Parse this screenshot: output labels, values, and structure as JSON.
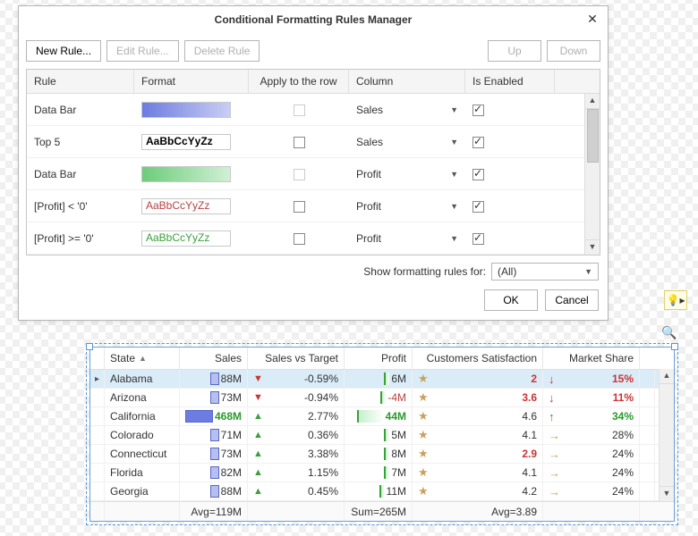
{
  "dialog": {
    "title": "Conditional Formatting Rules Manager",
    "buttons": {
      "new": "New Rule...",
      "edit": "Edit Rule...",
      "delete": "Delete Rule",
      "up": "Up",
      "down": "Down",
      "ok": "OK",
      "cancel": "Cancel"
    },
    "columns": {
      "rule": "Rule",
      "format": "Format",
      "apply": "Apply to the row",
      "column": "Column",
      "enabled": "Is Enabled"
    },
    "rules": [
      {
        "name": "Data Bar",
        "format_kind": "bar-blue",
        "format_text": "",
        "apply_row": false,
        "apply_faded": true,
        "column": "Sales",
        "enabled": true
      },
      {
        "name": "Top 5",
        "format_kind": "text",
        "format_text": "AaBbCcYyZz",
        "format_css": "fmt-bold",
        "apply_row": false,
        "apply_faded": false,
        "column": "Sales",
        "enabled": true
      },
      {
        "name": "Data Bar",
        "format_kind": "bar-green",
        "format_text": "",
        "apply_row": false,
        "apply_faded": true,
        "column": "Profit",
        "enabled": true
      },
      {
        "name": "[Profit] < '0'",
        "format_kind": "text",
        "format_text": "AaBbCcYyZz",
        "format_css": "fmt-red",
        "apply_row": false,
        "apply_faded": false,
        "column": "Profit",
        "enabled": true
      },
      {
        "name": "[Profit] >= '0'",
        "format_kind": "text",
        "format_text": "AaBbCcYyZz",
        "format_css": "fmt-green",
        "apply_row": false,
        "apply_faded": false,
        "column": "Profit",
        "enabled": true
      }
    ],
    "filter_label": "Show formatting rules for:",
    "filter_value": "(All)"
  },
  "grid": {
    "headers": {
      "state": "State",
      "sales": "Sales",
      "svt": "Sales vs Target",
      "profit": "Profit",
      "cs": "Customers Satisfaction",
      "ms": "Market Share"
    },
    "rows": [
      {
        "selected": true,
        "state": "Alabama",
        "sales": "88M",
        "sales_bold": false,
        "svt_dir": "dn",
        "svt": "-0.59%",
        "profit": "6M",
        "profit_bold": false,
        "cs": "2",
        "cs_bold": true,
        "ms_dir": "dn",
        "ms": "15%",
        "ms_bold": true
      },
      {
        "selected": false,
        "state": "Arizona",
        "sales": "73M",
        "sales_bold": false,
        "svt_dir": "dn",
        "svt": "-0.94%",
        "profit": "-4M",
        "profit_neg": true,
        "profit_bold": false,
        "cs": "3.6",
        "cs_bold": true,
        "ms_dir": "dn",
        "ms": "11%",
        "ms_bold": true
      },
      {
        "selected": false,
        "state": "California",
        "sales": "468M",
        "sales_bold": true,
        "svt_dir": "up",
        "svt": "2.77%",
        "profit": "44M",
        "profit_bold": true,
        "cs": "4.6",
        "cs_bold": false,
        "ms_dir": "up",
        "ms": "34%",
        "ms_bold": true
      },
      {
        "selected": false,
        "state": "Colorado",
        "sales": "71M",
        "sales_bold": false,
        "svt_dir": "up",
        "svt": "0.36%",
        "profit": "5M",
        "profit_bold": false,
        "cs": "4.1",
        "cs_bold": false,
        "ms_dir": "rt",
        "ms": "28%",
        "ms_bold": false
      },
      {
        "selected": false,
        "state": "Connecticut",
        "sales": "73M",
        "sales_bold": false,
        "svt_dir": "up",
        "svt": "3.38%",
        "profit": "8M",
        "profit_bold": false,
        "cs": "2.9",
        "cs_bold": true,
        "ms_dir": "rt",
        "ms": "24%",
        "ms_bold": false
      },
      {
        "selected": false,
        "state": "Florida",
        "sales": "82M",
        "sales_bold": false,
        "svt_dir": "up",
        "svt": "1.15%",
        "profit": "7M",
        "profit_bold": false,
        "cs": "4.1",
        "cs_bold": false,
        "ms_dir": "rt",
        "ms": "24%",
        "ms_bold": false
      },
      {
        "selected": false,
        "state": "Georgia",
        "sales": "88M",
        "sales_bold": false,
        "svt_dir": "up",
        "svt": "0.45%",
        "profit": "11M",
        "profit_bold": false,
        "cs": "4.2",
        "cs_bold": false,
        "ms_dir": "rt",
        "ms": "24%",
        "ms_bold": false
      }
    ],
    "footer": {
      "sales": "Avg=119M",
      "profit": "Sum=265M",
      "cs": "Avg=3.89"
    }
  }
}
